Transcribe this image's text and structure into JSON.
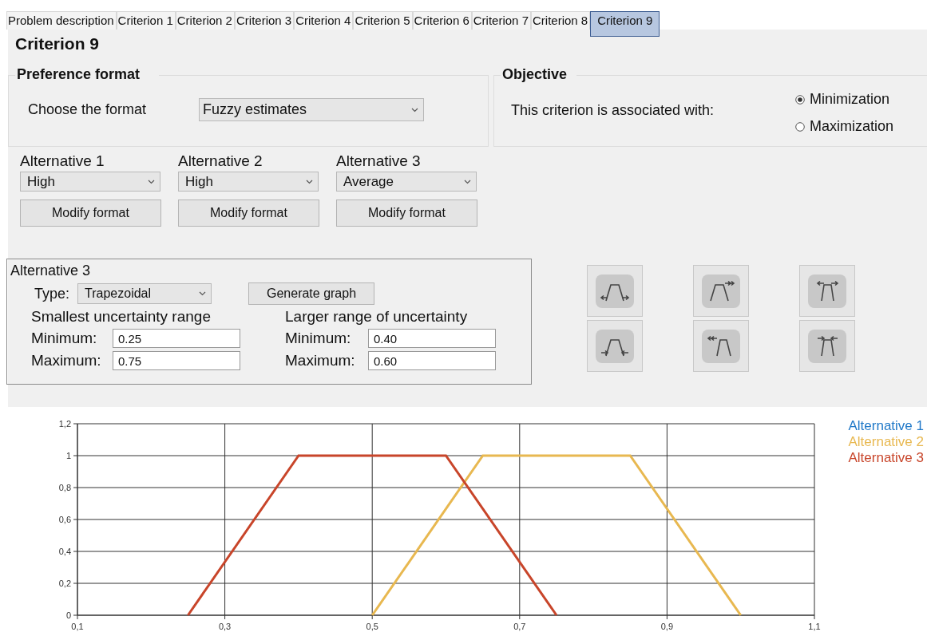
{
  "tabs": [
    {
      "label": "Problem description",
      "selected": false
    },
    {
      "label": "Criterion 1",
      "selected": false
    },
    {
      "label": "Criterion 2",
      "selected": false
    },
    {
      "label": "Criterion 3",
      "selected": false
    },
    {
      "label": "Criterion 4",
      "selected": false
    },
    {
      "label": "Criterion 5",
      "selected": false
    },
    {
      "label": "Criterion 6",
      "selected": false
    },
    {
      "label": "Criterion 7",
      "selected": false
    },
    {
      "label": "Criterion 8",
      "selected": false
    },
    {
      "label": "Criterion 9",
      "selected": true
    }
  ],
  "title": "Criterion 9",
  "preference_format": {
    "title": "Preference format",
    "label": "Choose the format",
    "value": "Fuzzy estimates"
  },
  "objective": {
    "title": "Objective",
    "label": "This criterion is associated with:",
    "options": [
      {
        "label": "Minimization",
        "selected": true
      },
      {
        "label": "Maximization",
        "selected": false
      }
    ]
  },
  "alternatives": [
    {
      "label": "Alternative 1",
      "value": "High",
      "button": "Modify format"
    },
    {
      "label": "Alternative 2",
      "value": "High",
      "button": "Modify format"
    },
    {
      "label": "Alternative 3",
      "value": "Average",
      "button": "Modify format"
    }
  ],
  "editor": {
    "title": "Alternative 3",
    "type_label": "Type:",
    "type_value": "Trapezoidal",
    "generate": "Generate graph",
    "ranges": [
      {
        "title": "Smallest uncertainty range",
        "min_label": "Minimum:",
        "min": "0.25",
        "max_label": "Maximum:",
        "max": "0.75"
      },
      {
        "title": "Larger range of uncertainty",
        "min_label": "Minimum:",
        "min": "0.40",
        "max_label": "Maximum:",
        "max": "0.60"
      }
    ]
  },
  "chart_data": {
    "type": "line",
    "grid": true,
    "x": [
      0.25,
      0.4,
      0.5,
      0.6,
      0.65,
      0.75,
      0.85,
      1.0
    ],
    "series": [
      {
        "name": "Alternative 1",
        "color": "#1f78c8",
        "values": [
          null,
          null,
          null,
          null,
          null,
          null,
          null,
          null
        ]
      },
      {
        "name": "Alternative 2",
        "color": "#e8b850",
        "values": [
          null,
          null,
          0,
          0.667,
          1,
          1,
          1,
          0
        ]
      },
      {
        "name": "Alternative 3",
        "color": "#c8452a",
        "values": [
          0,
          1,
          1,
          1,
          0.667,
          0,
          null,
          null
        ]
      }
    ],
    "xlim": [
      0.1,
      1.1
    ],
    "ylim": [
      0,
      1.2
    ],
    "xticks": [
      {
        "value": 0.1,
        "label": "0,1"
      },
      {
        "value": 0.3,
        "label": "0,3"
      },
      {
        "value": 0.5,
        "label": "0,5"
      },
      {
        "value": 0.7,
        "label": "0,7"
      },
      {
        "value": 0.9,
        "label": "0,9"
      },
      {
        "value": 1.1,
        "label": "1,1"
      }
    ],
    "yticks": [
      {
        "value": 0,
        "label": "0"
      },
      {
        "value": 0.2,
        "label": "0,2"
      },
      {
        "value": 0.4,
        "label": "0,4"
      },
      {
        "value": 0.6,
        "label": "0,6"
      },
      {
        "value": 0.8,
        "label": "0,8"
      },
      {
        "value": 1,
        "label": "1"
      },
      {
        "value": 1.2,
        "label": "1,2"
      }
    ]
  }
}
